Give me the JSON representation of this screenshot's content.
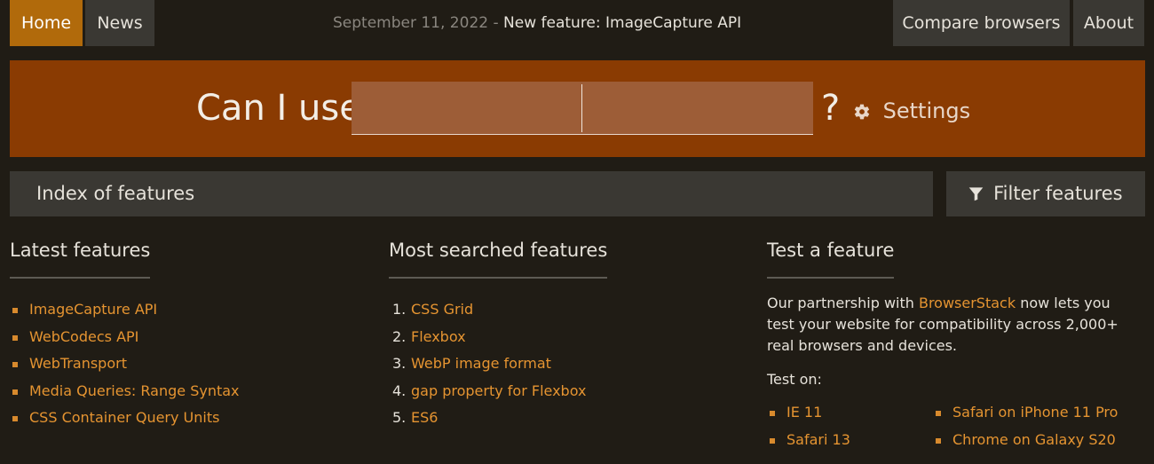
{
  "nav": {
    "home": "Home",
    "news": "News",
    "compare": "Compare browsers",
    "about": "About"
  },
  "news": {
    "date": "September 11, 2022 -",
    "headline": "New feature: ImageCapture API"
  },
  "hero": {
    "label": "Can I use",
    "question_mark": "?",
    "settings": "Settings",
    "search_value_1": "",
    "search_value_2": ""
  },
  "index_bar": {
    "label": "Index of features",
    "filter": "Filter features"
  },
  "latest": {
    "title": "Latest features",
    "items": [
      "ImageCapture API",
      "WebCodecs API",
      "WebTransport",
      "Media Queries: Range Syntax",
      "CSS Container Query Units"
    ]
  },
  "most_searched": {
    "title": "Most searched features",
    "items": [
      {
        "num": "1.",
        "label": "CSS Grid"
      },
      {
        "num": "2.",
        "label": "Flexbox"
      },
      {
        "num": "3.",
        "label": "WebP image format"
      },
      {
        "num": "4.",
        "label": "gap property for Flexbox"
      },
      {
        "num": "5.",
        "label": "ES6"
      }
    ]
  },
  "test": {
    "title": "Test a feature",
    "text_before": "Our partnership with ",
    "partner": "BrowserStack",
    "text_after": " now lets you test your website for compatibility across 2,000+ real browsers and devices.",
    "test_on": "Test on:",
    "left": [
      "IE 11",
      "Safari 13"
    ],
    "right": [
      "Safari on iPhone 11 Pro",
      "Chrome on Galaxy S20"
    ]
  },
  "colors": {
    "background": "#201c15",
    "accent_orange": "#b16a0b",
    "hero": "#8a3b02",
    "link": "#e59431",
    "button_bg": "#3a3833"
  },
  "icons": [
    "gear-icon",
    "filter-icon"
  ]
}
